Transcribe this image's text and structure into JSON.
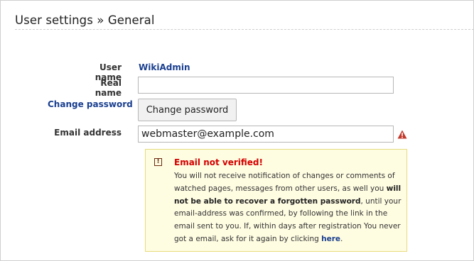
{
  "header": {
    "title": "User settings » General"
  },
  "form": {
    "username_label": "User name",
    "username_value": "WikiAdmin",
    "realname_label": "Real name",
    "realname_value": "",
    "change_password_link": "Change password",
    "change_password_button": "Change password",
    "email_label": "Email address",
    "email_value": "webmaster@example.com"
  },
  "notice": {
    "icon": "exclamation-icon",
    "title": "Email not verified!",
    "text_1": "You will not receive notification of changes or comments of watched pages, messages from other users, as well you ",
    "text_bold": "will not be able to recover a forgotten password",
    "text_2": ", until your email-address was confirmed, by following the link in the email sent to you. If, within days after registration You never got a email, ask for it again by clicking ",
    "link_text": "here",
    "text_3": "."
  },
  "colors": {
    "link": "#1a3f8f",
    "error": "#d40000",
    "notice_bg": "#fefce1",
    "notice_border": "#e6dc7e",
    "warning_icon": "#c0392b"
  }
}
